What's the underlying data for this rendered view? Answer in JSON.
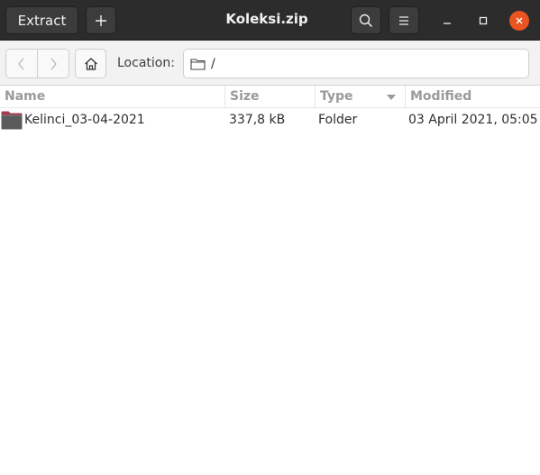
{
  "window": {
    "title": "Koleksi.zip"
  },
  "headerbar": {
    "extract_label": "Extract",
    "add_icon": "plus-icon",
    "search_icon": "search-icon",
    "menu_icon": "hamburger-menu-icon",
    "close_color": "#e95420"
  },
  "toolbar": {
    "back_icon": "chevron-left-icon",
    "forward_icon": "chevron-right-icon",
    "home_icon": "home-icon",
    "location_label": "Location:",
    "location_path": "/"
  },
  "columns": {
    "name": "Name",
    "size": "Size",
    "type": "Type",
    "modified": "Modified"
  },
  "rows": [
    {
      "icon": "folder-icon",
      "name": "Kelinci_03-04-2021",
      "size": "337,8 kB",
      "type": "Folder",
      "modified": "03 April 2021, 05:05"
    }
  ]
}
